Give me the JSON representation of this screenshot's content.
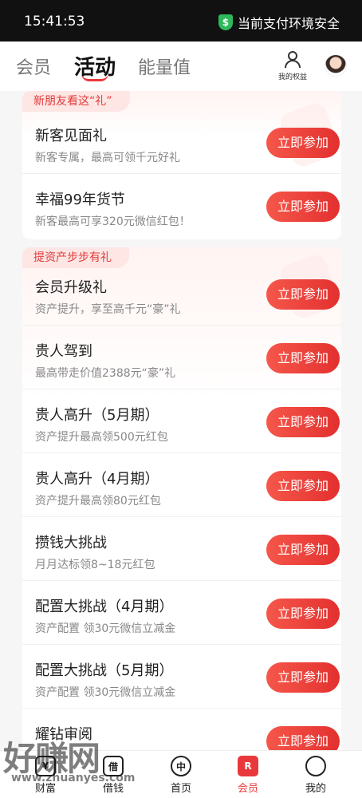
{
  "status_bar": {
    "time": "15:41:53",
    "secure_text": "当前支付环境安全",
    "secure_icon": "$"
  },
  "header": {
    "tabs": [
      {
        "label": "会员",
        "active": false
      },
      {
        "label": "活动",
        "active": true
      },
      {
        "label": "能量值",
        "active": false
      }
    ],
    "rights_label": "我的权益"
  },
  "sections": [
    {
      "tag": "新朋友看这“礼”",
      "items": [
        {
          "title": "新客见面礼",
          "subtitle": "新客专属，最高可领千元好礼",
          "button": "立即参加"
        },
        {
          "title": "幸福99年货节",
          "subtitle": "新客最高可享320元微信红包！",
          "button": "立即参加"
        }
      ]
    },
    {
      "tag": "提资产步步有礼",
      "items": [
        {
          "title": "会员升级礼",
          "subtitle": "资产提升，享至高千元“豪”礼",
          "button": "立即参加"
        },
        {
          "title": "贵人驾到",
          "subtitle": "最高带走价值2388元“豪”礼",
          "button": "立即参加"
        },
        {
          "title": "贵人高升（5月期）",
          "subtitle": "资产提升最高领500元红包",
          "button": "立即参加"
        },
        {
          "title": "贵人高升（4月期）",
          "subtitle": "资产提升最高领80元红包",
          "button": "立即参加"
        },
        {
          "title": "攒钱大挑战",
          "subtitle": "月月达标领8~18元红包",
          "button": "立即参加"
        },
        {
          "title": "配置大挑战（4月期）",
          "subtitle": "资产配置 领30元微信立减金",
          "button": "立即参加"
        },
        {
          "title": "配置大挑战（5月期）",
          "subtitle": "资产配置 领30元微信立减金",
          "button": "立即参加"
        },
        {
          "title": "耀钻审阅",
          "subtitle": "",
          "button": "立即参加"
        }
      ]
    }
  ],
  "tabbar": [
    {
      "label": "财富",
      "icon": "wealth-icon",
      "glyph": "¥",
      "active": false
    },
    {
      "label": "借钱",
      "icon": "loan-icon",
      "glyph": "借",
      "active": false
    },
    {
      "label": "首页",
      "icon": "home-icon",
      "glyph": "中",
      "active": false
    },
    {
      "label": "会员",
      "icon": "member-icon",
      "glyph": "R",
      "active": true
    },
    {
      "label": "我的",
      "icon": "profile-icon",
      "glyph": "",
      "active": false
    }
  ],
  "watermark": {
    "text": "好赚网",
    "url": "www.zhuanyes.com"
  },
  "colors": {
    "accent": "#e8383b",
    "secure": "#2eb85c"
  }
}
